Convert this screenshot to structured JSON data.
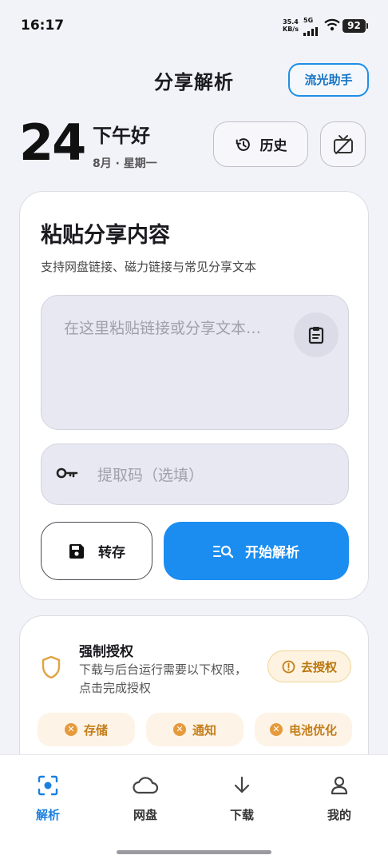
{
  "status_bar": {
    "time": "16:17",
    "net_speed_value": "35.4",
    "net_speed_unit": "KB/s",
    "network": "5G",
    "battery": "92"
  },
  "header": {
    "title": "分享解析",
    "helper_button": "流光助手"
  },
  "greeting": {
    "day": "24",
    "text": "下午好",
    "date": "8月 · 星期一",
    "history_button": "历史"
  },
  "paste_card": {
    "title": "粘贴分享内容",
    "subtitle": "支持网盘链接、磁力链接与常见分享文本",
    "paste_placeholder": "在这里粘贴链接或分享文本…",
    "code_placeholder": "提取码（选填）",
    "save_button": "转存",
    "parse_button": "开始解析"
  },
  "auth_card": {
    "title": "强制授权",
    "description": "下载与后台运行需要以下权限，点击完成授权",
    "go_button": "去授权",
    "chips": [
      "存储",
      "通知",
      "电池优化"
    ]
  },
  "bottom_nav": {
    "items": [
      "解析",
      "网盘",
      "下载",
      "我的"
    ],
    "active": "解析"
  },
  "colors": {
    "accent": "#1b8df0",
    "warning": "#e59a3c",
    "background": "#f2f2f9"
  },
  "icons": [
    "history-icon",
    "cast-off-icon",
    "clipboard-icon",
    "key-icon",
    "save-icon",
    "search-list-icon",
    "shield-icon",
    "alert-icon",
    "close-circle-icon",
    "scan-icon",
    "cloud-icon",
    "download-icon",
    "user-icon"
  ]
}
